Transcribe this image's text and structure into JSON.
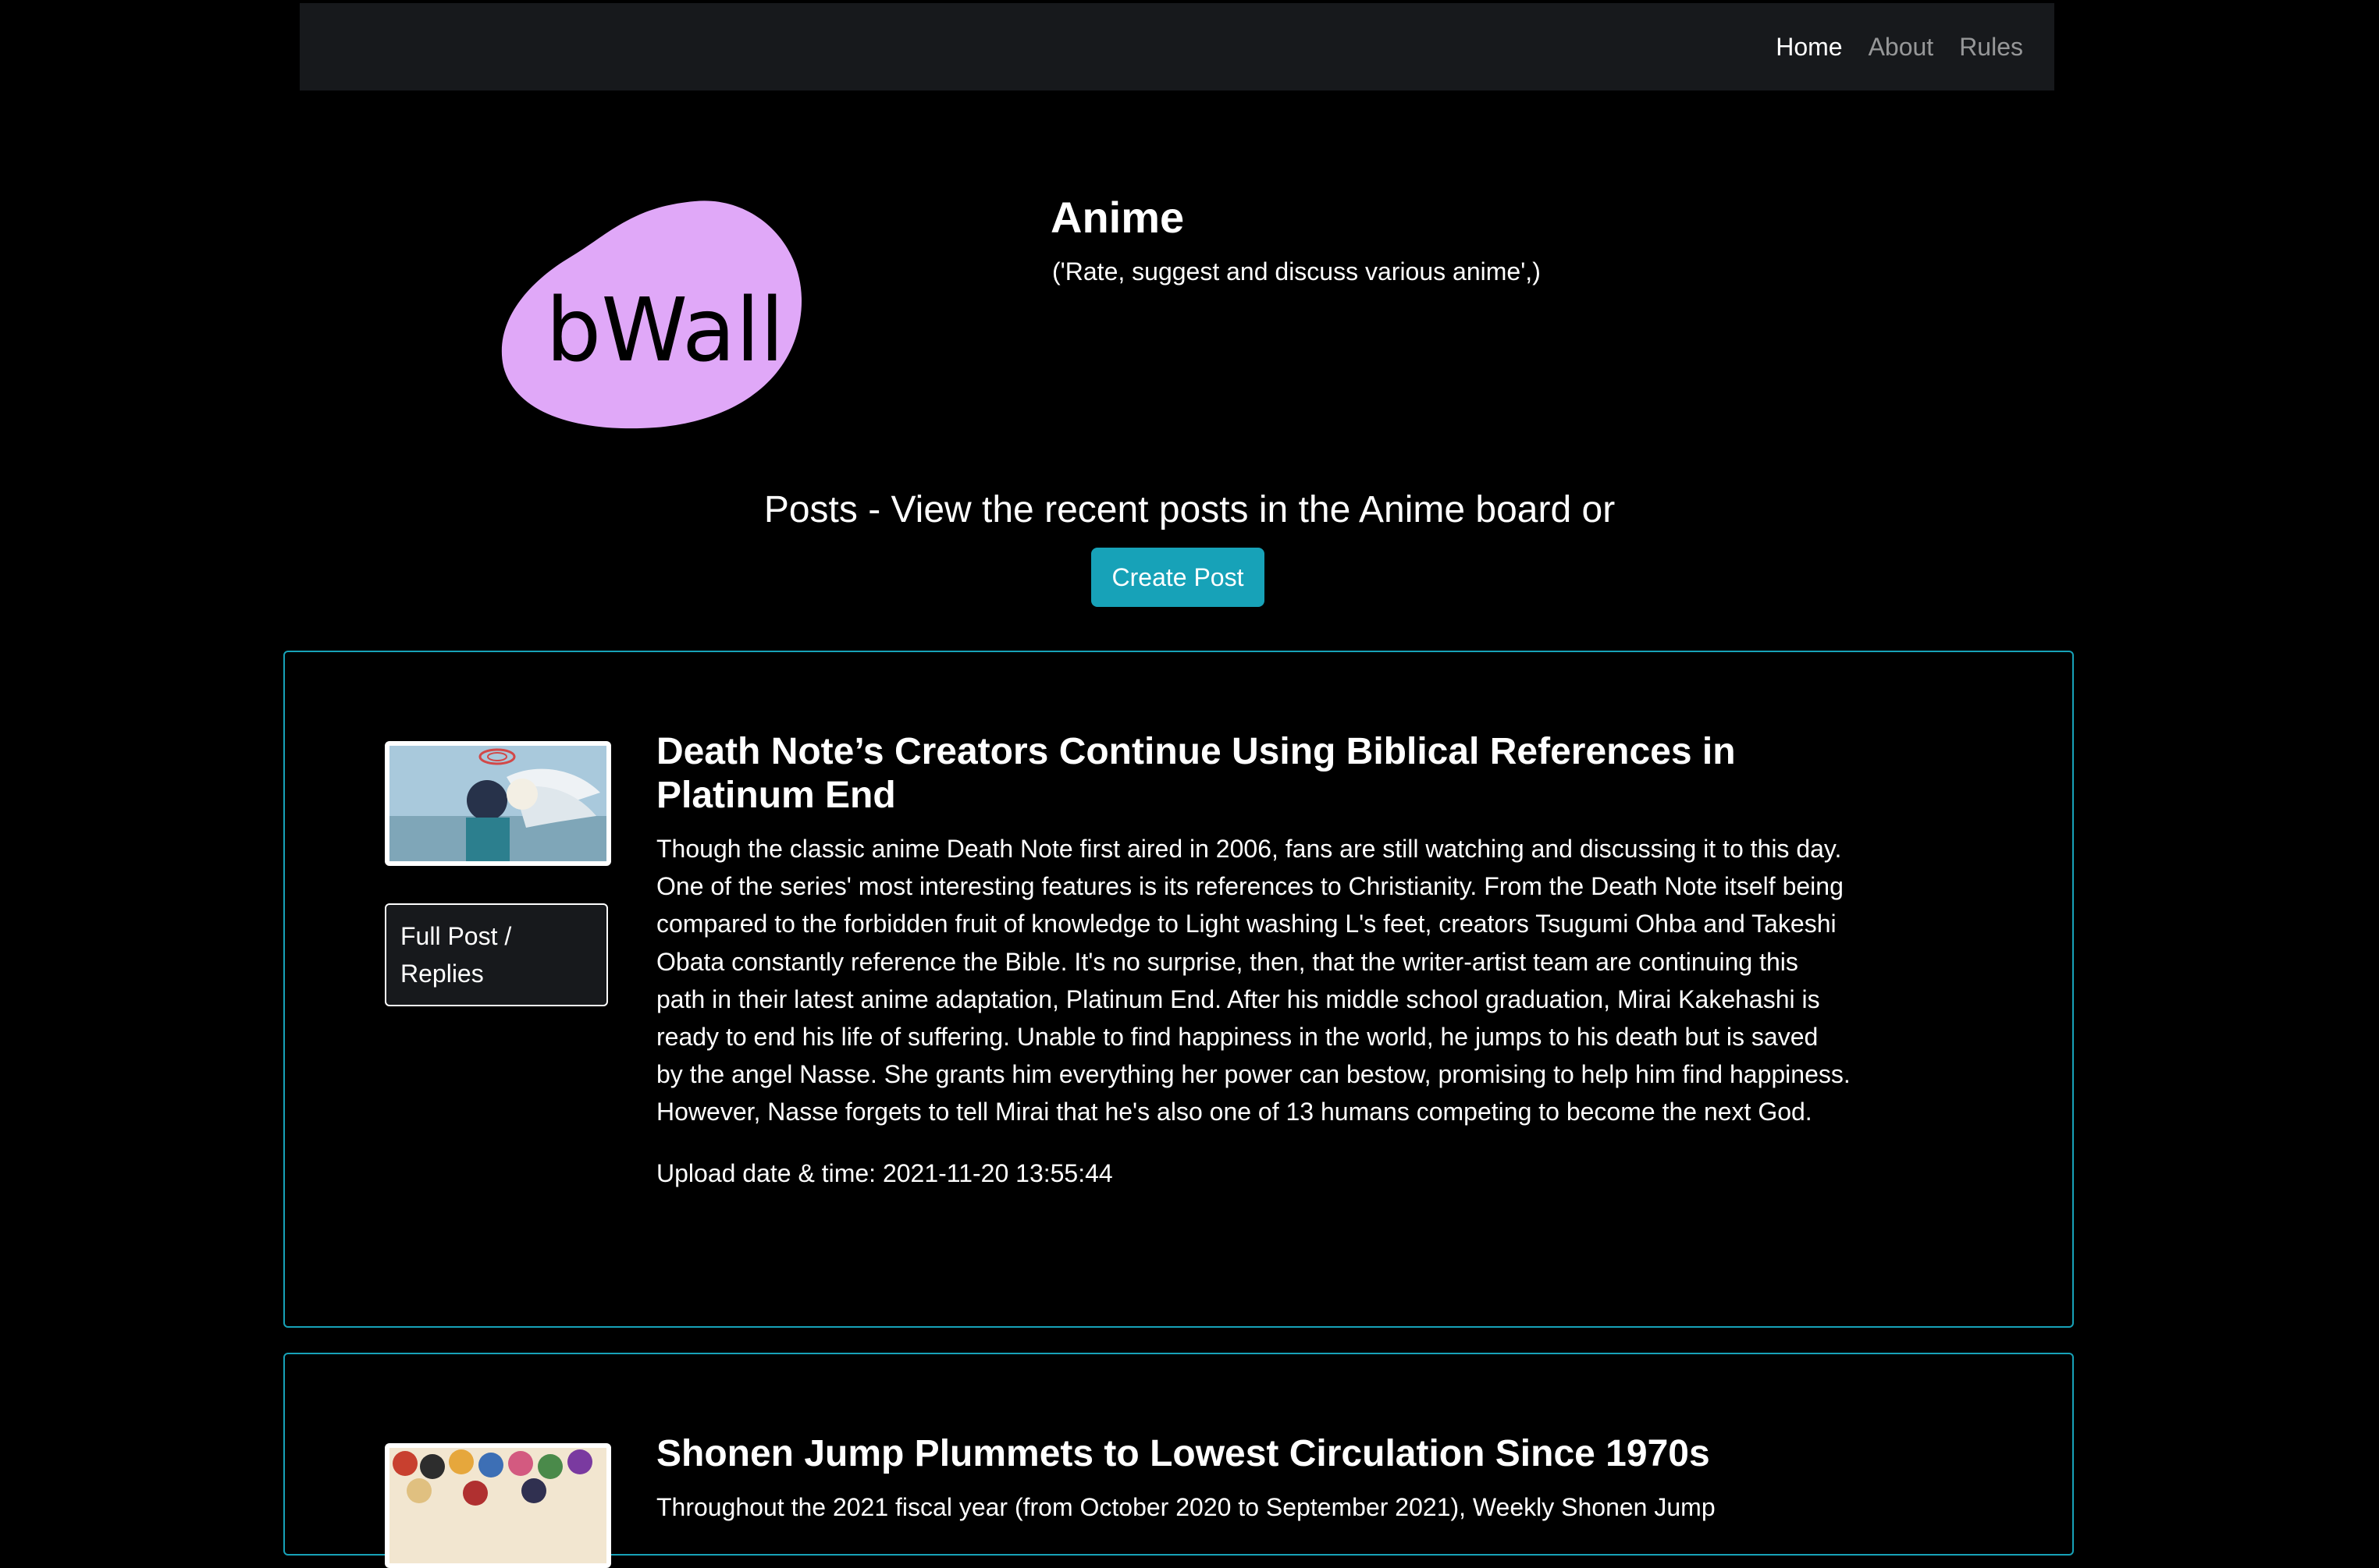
{
  "nav": {
    "links": [
      "Home",
      "About",
      "Rules"
    ]
  },
  "board": {
    "logo_text": "bWall",
    "title": "Anime",
    "description": "('Rate, suggest and discuss various anime',)"
  },
  "posts_section": {
    "heading": "Posts - View the recent posts in the Anime board or",
    "create_button": "Create Post"
  },
  "posts": [
    {
      "title": "Death Note’s Creators Continue Using Biblical References in Platinum End",
      "body": "Though the classic anime Death Note first aired in 2006, fans are still watching and discussing it to this day. One of the series' most interesting features is its references to Christianity. From the Death Note itself being compared to the forbidden fruit of knowledge to Light washing L's feet, creators Tsugumi Ohba and Takeshi Obata constantly reference the Bible. It's no surprise, then, that the writer-artist team are continuing this path in their latest anime adaptation, Platinum End. After his middle school graduation, Mirai Kakehashi is ready to end his life of suffering. Unable to find happiness in the world, he jumps to his death but is saved by the angel Nasse. She grants him everything her power can bestow, promising to help him find happiness. However, Nasse forgets to tell Mirai that he's also one of 13 humans competing to become the next God.",
      "upload": "Upload date & time: 2021-11-20 13:55:44",
      "button": "Full Post / Replies"
    },
    {
      "title": "Shonen Jump Plummets to Lowest Circulation Since 1970s",
      "body": "Throughout the 2021 fiscal year (from October 2020 to September 2021), Weekly Shonen Jump"
    }
  ],
  "colors": {
    "accent": "#17a2b8",
    "navbar_bg": "#17191c",
    "logo_fill": "#e0a8f8",
    "page_bg": "#000000"
  }
}
